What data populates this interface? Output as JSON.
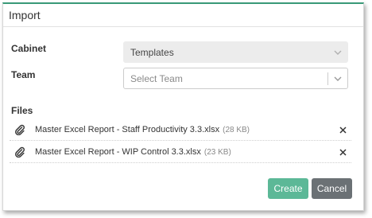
{
  "dialog": {
    "title": "Import"
  },
  "form": {
    "cabinet_label": "Cabinet",
    "cabinet_value": "Templates",
    "team_label": "Team",
    "team_placeholder": "Select Team",
    "files_label": "Files"
  },
  "files": [
    {
      "name": "Master Excel Report - Staff Productivity 3.3.xlsx",
      "size": "(28 KB)"
    },
    {
      "name": "Master Excel Report - WIP Control 3.3.xlsx",
      "size": "(23 KB)"
    }
  ],
  "buttons": {
    "create": "Create",
    "cancel": "Cancel"
  },
  "colors": {
    "accent": "#3a9a78",
    "create": "#5cb897",
    "cancel": "#6b7175"
  },
  "icons": {
    "file": "paperclip-icon",
    "remove": "close-icon",
    "dropdown": "chevron-down-icon"
  }
}
